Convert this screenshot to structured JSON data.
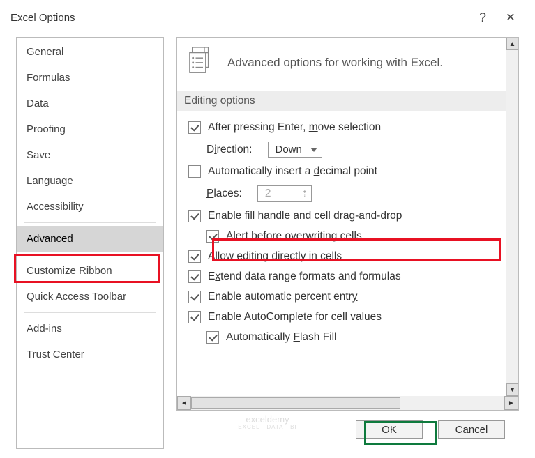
{
  "title": "Excel Options",
  "sidebar": {
    "items": [
      {
        "label": "General"
      },
      {
        "label": "Formulas"
      },
      {
        "label": "Data"
      },
      {
        "label": "Proofing"
      },
      {
        "label": "Save"
      },
      {
        "label": "Language"
      },
      {
        "label": "Accessibility"
      },
      {
        "label": "Advanced",
        "selected": true
      },
      {
        "label": "Customize Ribbon"
      },
      {
        "label": "Quick Access Toolbar"
      },
      {
        "label": "Add-ins"
      },
      {
        "label": "Trust Center"
      }
    ]
  },
  "content": {
    "header": "Advanced options for working with Excel.",
    "section_title": "Editing options",
    "opt_enter": {
      "label_pre": "After pressing Enter, ",
      "label_u": "m",
      "label_post": "ove selection",
      "checked": true
    },
    "direction": {
      "label_pre": "D",
      "label_u": "i",
      "label_post": "rection:",
      "value": "Down"
    },
    "opt_decimal": {
      "label_pre": "Automatically insert a ",
      "label_u": "d",
      "label_post": "ecimal point",
      "checked": false
    },
    "places": {
      "label_u": "P",
      "label_post": "laces:",
      "value": "2"
    },
    "opt_fill": {
      "label_pre": "Enable fill handle and cell ",
      "label_u": "d",
      "label_post": "rag-and-drop",
      "checked": true
    },
    "opt_alert": {
      "label_u": "A",
      "label_post": "lert before overwriting cells",
      "checked": true
    },
    "opt_editcell": {
      "label_pre": "Allow ",
      "label_u": "e",
      "label_post": "diting directly in cells",
      "checked": true
    },
    "opt_extend": {
      "label_pre": "E",
      "label_u": "x",
      "label_post": "tend data range formats and formulas",
      "checked": true
    },
    "opt_percent": {
      "label_pre": "Enable automatic percent entr",
      "label_u": "y",
      "checked": true
    },
    "opt_autocomp": {
      "label_pre": "Enable ",
      "label_u": "A",
      "label_post": "utoComplete for cell values",
      "checked": true
    },
    "opt_flash": {
      "label_pre": "Automatically ",
      "label_u": "F",
      "label_post": "lash Fill",
      "checked": true
    }
  },
  "buttons": {
    "ok": "OK",
    "cancel": "Cancel"
  },
  "watermark": {
    "line1": "exceldemy",
    "line2": "EXCEL · DATA · BI"
  }
}
